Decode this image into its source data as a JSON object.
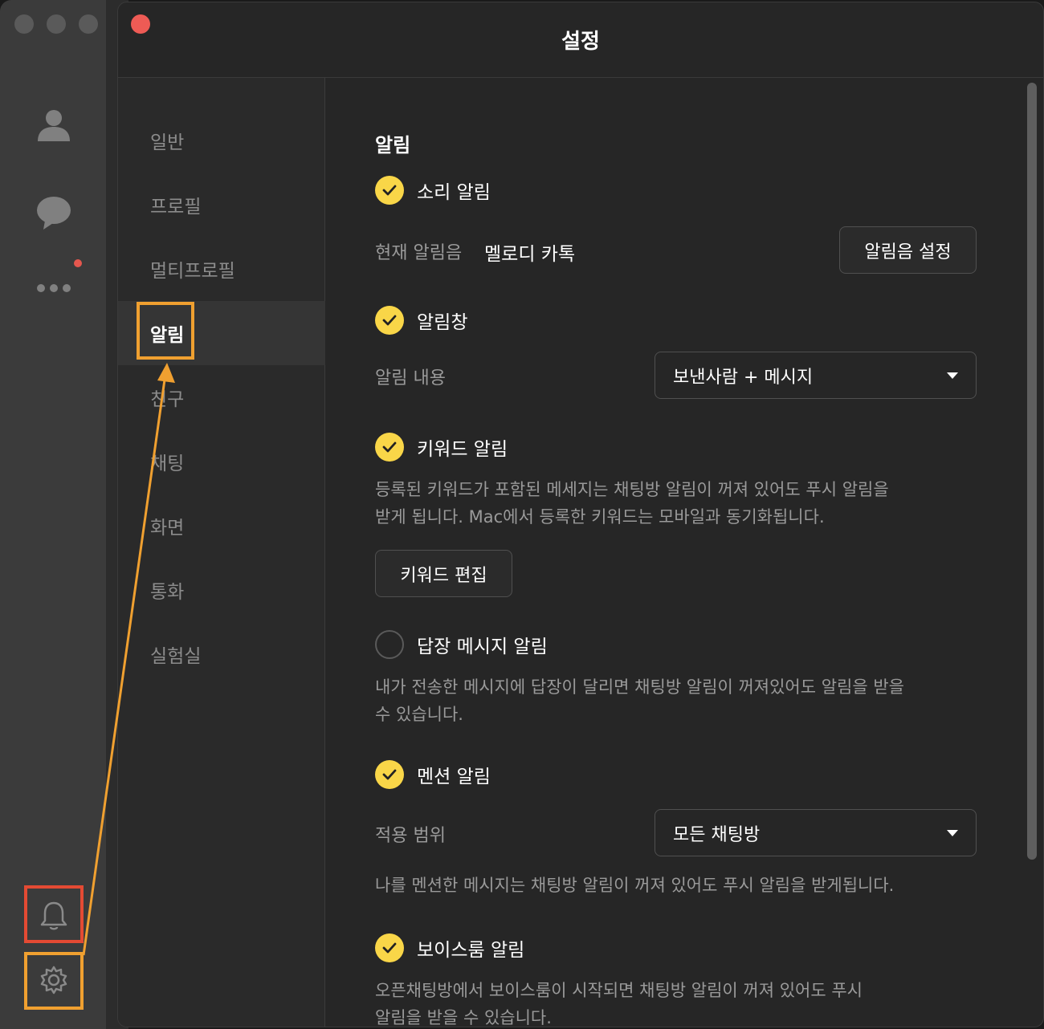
{
  "window": {
    "title": "설정"
  },
  "nav": {
    "items": [
      {
        "label": "일반"
      },
      {
        "label": "프로필"
      },
      {
        "label": "멀티프로필"
      },
      {
        "label": "알림"
      },
      {
        "label": "친구"
      },
      {
        "label": "채팅"
      },
      {
        "label": "화면"
      },
      {
        "label": "통화"
      },
      {
        "label": "실험실"
      }
    ],
    "active": "알림"
  },
  "content": {
    "section_title": "알림",
    "sound": {
      "label": "소리 알림",
      "current_label": "현재 알림음",
      "current_value": "멜로디 카톡",
      "button": "알림음 설정"
    },
    "popup": {
      "label": "알림창",
      "content_label": "알림 내용",
      "content_value": "보낸사람 + 메시지"
    },
    "keyword": {
      "label": "키워드 알림",
      "desc_line1": "등록된 키워드가 포함된 메세지는 채팅방 알림이 꺼져 있어도 푸시 알림을",
      "desc_line2": "받게 됩니다. Mac에서 등록한 키워드는 모바일과 동기화됩니다.",
      "button": "키워드 편집"
    },
    "reply": {
      "label": "답장 메시지 알림",
      "desc_line1": "내가 전송한 메시지에 답장이 달리면 채팅방 알림이 꺼져있어도 알림을 받을",
      "desc_line2": "수 있습니다."
    },
    "mention": {
      "label": "멘션 알림",
      "scope_label": "적용 범위",
      "scope_value": "모든 채팅방",
      "desc": "나를 멘션한 메시지는 채팅방 알림이 꺼져 있어도 푸시 알림을 받게됩니다."
    },
    "voiceroom": {
      "label": "보이스룸 알림",
      "desc_line1": "오픈채팅방에서 보이스룸이 시작되면 채팅방 알림이 꺼져 있어도 푸시",
      "desc_line2": "알림을 받을 수 있습니다."
    }
  },
  "colors": {
    "accent": "#f9d648",
    "highlight_orange": "#f0a030",
    "highlight_red": "#e44a33"
  }
}
